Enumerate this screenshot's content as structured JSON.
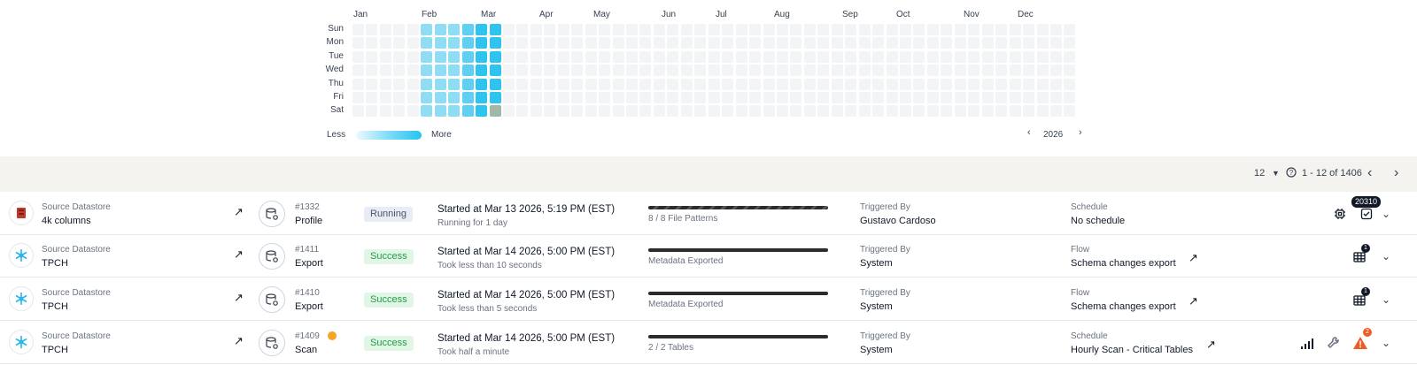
{
  "heatmap": {
    "months": [
      "Jan",
      "Feb",
      "Mar",
      "Apr",
      "May",
      "Jun",
      "Jul",
      "Aug",
      "Sep",
      "Oct",
      "Nov",
      "Dec"
    ],
    "days": [
      "Sun",
      "Mon",
      "Tue",
      "Wed",
      "Thu",
      "Fri",
      "Sat"
    ],
    "active_weeks_light": [
      5,
      6,
      7,
      8
    ],
    "active_weeks_dark": [
      9,
      10
    ],
    "colors": {
      "empty": "#f3f4f6",
      "light": "#8fdcf5",
      "mid": "#5fcff2",
      "dark": "#2ec4ef"
    },
    "legend_less": "Less",
    "legend_more": "More",
    "year": "2026"
  },
  "toolbar": {
    "page_size": "12",
    "range": "1 - 12 of 1406"
  },
  "rows": [
    {
      "source_label": "Source Datastore",
      "source_name": "4k columns",
      "source_icon": "database-red-icon",
      "op_id": "#1332",
      "op_type": "Profile",
      "status": "Running",
      "started": "Started at Mar 13 2026, 5:19 PM (EST)",
      "duration": "Running for 1 day",
      "progress_text": "8 / 8 File Patterns",
      "triggered_label": "Triggered By",
      "triggered_by": "Gustavo Cardoso",
      "sched_label": "Schedule",
      "sched_value": "No schedule",
      "counter": "20310"
    },
    {
      "source_label": "Source Datastore",
      "source_name": "TPCH",
      "source_icon": "snowflake-icon",
      "op_id": "#1411",
      "op_type": "Export",
      "status": "Success",
      "started": "Started at Mar 14 2026, 5:00 PM (EST)",
      "duration": "Took less than 10 seconds",
      "progress_text": "Metadata Exported",
      "triggered_label": "Triggered By",
      "triggered_by": "System",
      "sched_label": "Flow",
      "sched_value": "Schema changes export",
      "counter": "1"
    },
    {
      "source_label": "Source Datastore",
      "source_name": "TPCH",
      "source_icon": "snowflake-icon",
      "op_id": "#1410",
      "op_type": "Export",
      "status": "Success",
      "started": "Started at Mar 14 2026, 5:00 PM (EST)",
      "duration": "Took less than 5 seconds",
      "progress_text": "Metadata Exported",
      "triggered_label": "Triggered By",
      "triggered_by": "System",
      "sched_label": "Flow",
      "sched_value": "Schema changes export",
      "counter": "1"
    },
    {
      "source_label": "Source Datastore",
      "source_name": "TPCH",
      "source_icon": "snowflake-icon",
      "op_id": "#1409",
      "op_type": "Scan",
      "status": "Success",
      "started": "Started at Mar 14 2026, 5:00 PM (EST)",
      "duration": "Took half a minute",
      "progress_text": "2 / 2 Tables",
      "triggered_label": "Triggered By",
      "triggered_by": "System",
      "sched_label": "Schedule",
      "sched_value": "Hourly Scan - Critical Tables",
      "counter": "2"
    }
  ]
}
